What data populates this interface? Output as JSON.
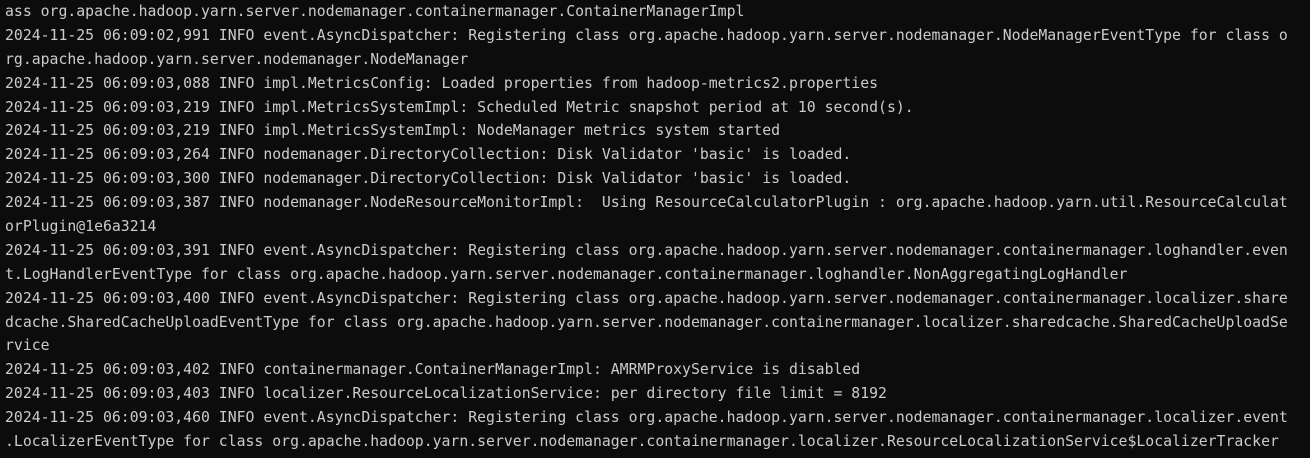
{
  "terminal": {
    "lines": [
      "ass org.apache.hadoop.yarn.server.nodemanager.containermanager.ContainerManagerImpl",
      "2024-11-25 06:09:02,991 INFO event.AsyncDispatcher: Registering class org.apache.hadoop.yarn.server.nodemanager.NodeManagerEventType for class o",
      "rg.apache.hadoop.yarn.server.nodemanager.NodeManager",
      "2024-11-25 06:09:03,088 INFO impl.MetricsConfig: Loaded properties from hadoop-metrics2.properties",
      "2024-11-25 06:09:03,219 INFO impl.MetricsSystemImpl: Scheduled Metric snapshot period at 10 second(s).",
      "2024-11-25 06:09:03,219 INFO impl.MetricsSystemImpl: NodeManager metrics system started",
      "2024-11-25 06:09:03,264 INFO nodemanager.DirectoryCollection: Disk Validator 'basic' is loaded.",
      "2024-11-25 06:09:03,300 INFO nodemanager.DirectoryCollection: Disk Validator 'basic' is loaded.",
      "2024-11-25 06:09:03,387 INFO nodemanager.NodeResourceMonitorImpl:  Using ResourceCalculatorPlugin : org.apache.hadoop.yarn.util.ResourceCalculat",
      "orPlugin@1e6a3214",
      "2024-11-25 06:09:03,391 INFO event.AsyncDispatcher: Registering class org.apache.hadoop.yarn.server.nodemanager.containermanager.loghandler.even",
      "t.LogHandlerEventType for class org.apache.hadoop.yarn.server.nodemanager.containermanager.loghandler.NonAggregatingLogHandler",
      "2024-11-25 06:09:03,400 INFO event.AsyncDispatcher: Registering class org.apache.hadoop.yarn.server.nodemanager.containermanager.localizer.share",
      "dcache.SharedCacheUploadEventType for class org.apache.hadoop.yarn.server.nodemanager.containermanager.localizer.sharedcache.SharedCacheUploadSe",
      "rvice",
      "2024-11-25 06:09:03,402 INFO containermanager.ContainerManagerImpl: AMRMProxyService is disabled",
      "2024-11-25 06:09:03,403 INFO localizer.ResourceLocalizationService: per directory file limit = 8192",
      "2024-11-25 06:09:03,460 INFO event.AsyncDispatcher: Registering class org.apache.hadoop.yarn.server.nodemanager.containermanager.localizer.event",
      ".LocalizerEventType for class org.apache.hadoop.yarn.server.nodemanager.containermanager.localizer.ResourceLocalizationService$LocalizerTracker"
    ]
  }
}
